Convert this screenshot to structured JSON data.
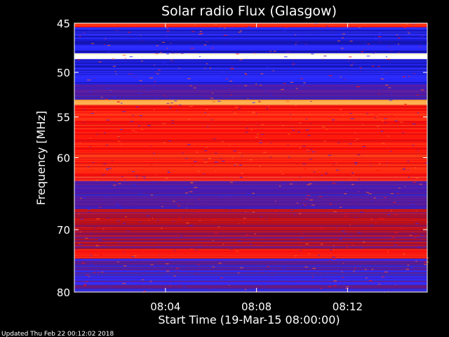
{
  "chart_data": {
    "type": "heatmap",
    "title": "Solar radio Flux (Glasgow)",
    "ylabel": "Frequency [MHz]",
    "xlabel": "Start Time (19-Mar-15 08:00:00)",
    "ylim": [
      45,
      80
    ],
    "y_scale": "log",
    "y_ticks": [
      45,
      50,
      55,
      60,
      70,
      80
    ],
    "xlim": [
      "08:00:00",
      "08:15:30"
    ],
    "x_ticks": [
      "08:04",
      "08:08",
      "08:12"
    ],
    "colormap": [
      "#000000",
      "#1010a0",
      "#2a2aff",
      "#7020a0",
      "#c00020",
      "#ff1010",
      "#ff8000",
      "#ffff80",
      "#ffffff"
    ],
    "bands": [
      {
        "from": 45.0,
        "to": 45.4,
        "level": "red"
      },
      {
        "from": 45.4,
        "to": 48.0,
        "level": "blue"
      },
      {
        "from": 48.0,
        "to": 48.6,
        "level": "white"
      },
      {
        "from": 48.6,
        "to": 51.3,
        "level": "blue"
      },
      {
        "from": 51.3,
        "to": 53.0,
        "level": "purple"
      },
      {
        "from": 53.0,
        "to": 53.6,
        "level": "orange"
      },
      {
        "from": 53.6,
        "to": 62.5,
        "level": "red"
      },
      {
        "from": 62.5,
        "to": 63.1,
        "level": "bright-red"
      },
      {
        "from": 63.1,
        "to": 67.0,
        "level": "purple"
      },
      {
        "from": 67.0,
        "to": 73.0,
        "level": "dark-red"
      },
      {
        "from": 73.0,
        "to": 74.5,
        "level": "red"
      },
      {
        "from": 74.5,
        "to": 80.0,
        "level": "purple-blue"
      }
    ]
  },
  "footer": {
    "updated": "Updated Thu Feb 22 00:12:02 2018"
  }
}
